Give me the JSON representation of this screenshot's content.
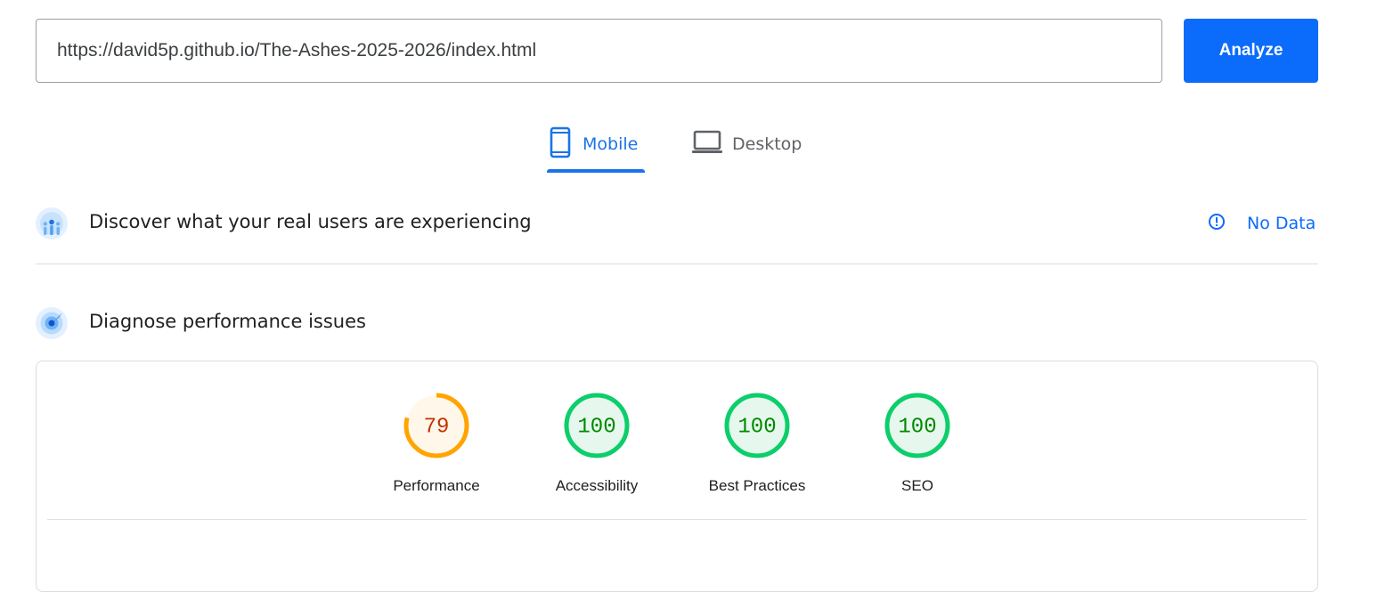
{
  "url_bar": {
    "value": "https://david5p.github.io/The-Ashes-2025-2026/index.html",
    "button_label": "Analyze"
  },
  "device_tabs": [
    {
      "label": "Mobile",
      "icon": "smartphone-icon",
      "selected": true
    },
    {
      "label": "Desktop",
      "icon": "laptop-icon",
      "selected": false
    }
  ],
  "real_users": {
    "title": "Discover what your real users are experiencing",
    "icon": "users-chart-icon",
    "status_label": "No Data",
    "status_icon": "info-icon"
  },
  "diagnose": {
    "title": "Diagnose performance issues",
    "icon": "lighthouse-radar-icon"
  },
  "scores": [
    {
      "label": "Performance",
      "value": 79,
      "display": "79",
      "status": "average"
    },
    {
      "label": "Accessibility",
      "value": 100,
      "display": "100",
      "status": "pass"
    },
    {
      "label": "Best Practices",
      "value": 100,
      "display": "100",
      "status": "pass"
    },
    {
      "label": "SEO",
      "value": 100,
      "display": "100",
      "status": "pass"
    }
  ],
  "colors": {
    "accent": "#1a73e8",
    "button": "#0b6bfa",
    "pass_stroke": "#0cce6b",
    "pass_fill": "#e6f8ed",
    "pass_text": "#008800",
    "average_stroke": "#ffa400",
    "average_fill": "#fff7ea",
    "average_text": "#c33300"
  }
}
